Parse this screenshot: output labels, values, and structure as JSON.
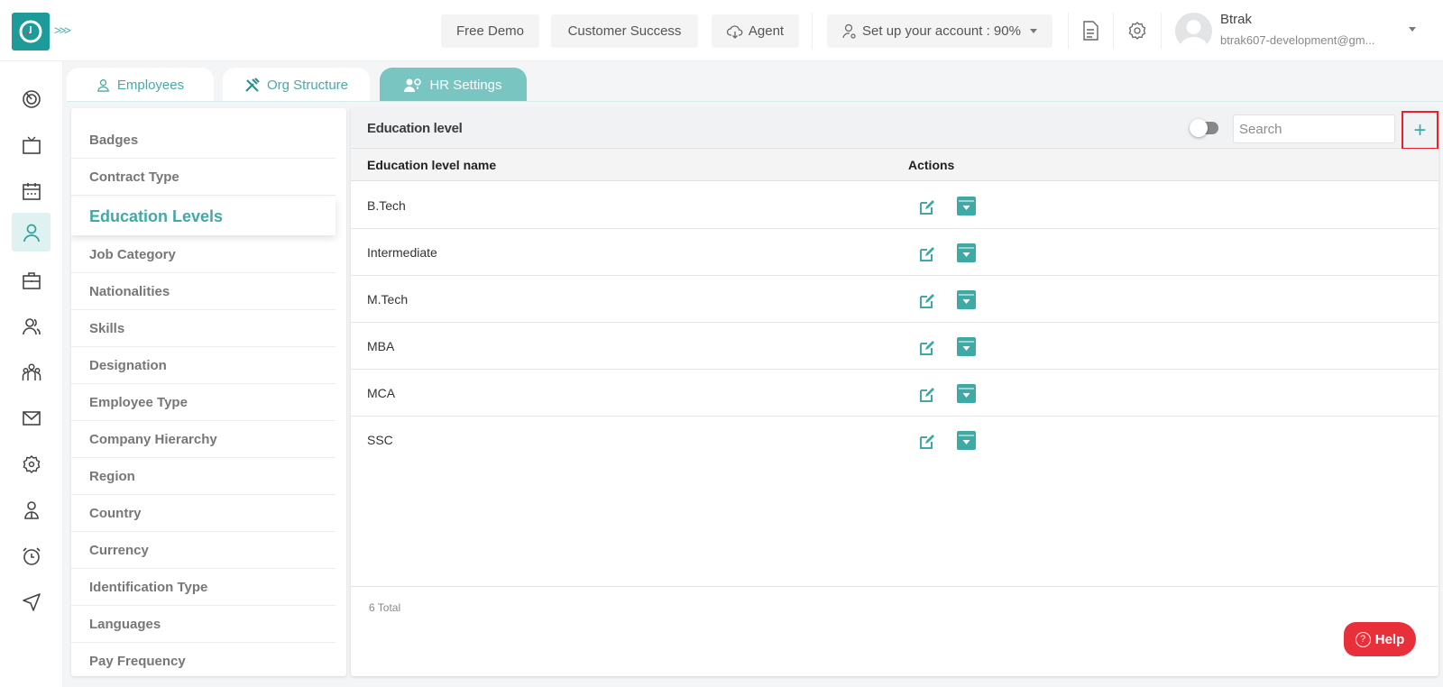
{
  "topbar": {
    "free_demo": "Free Demo",
    "customer_success": "Customer Success",
    "agent": "Agent",
    "setup_account": "Set up your account : 90%",
    "user": {
      "name": "Btrak",
      "email": "btrak607-development@gm..."
    }
  },
  "tabs": [
    {
      "label": "Employees",
      "icon": "user-icon"
    },
    {
      "label": "Org Structure",
      "icon": "tools-icon"
    },
    {
      "label": "HR Settings",
      "icon": "users-gear-icon",
      "active": true
    }
  ],
  "settings_menu": {
    "items": [
      "Badges",
      "Contract Type",
      "Education Levels",
      "Job Category",
      "Nationalities",
      "Skills",
      "Designation",
      "Employee Type",
      "Company Hierarchy",
      "Region",
      "Country",
      "Currency",
      "Identification Type",
      "Languages",
      "Pay Frequency"
    ],
    "active": "Education Levels"
  },
  "panel": {
    "title": "Education level",
    "search_placeholder": "Search",
    "add_label": "+",
    "columns": [
      "Education level name",
      "Actions"
    ],
    "rows": [
      "B.Tech",
      "Intermediate",
      "M.Tech",
      "MBA",
      "MCA",
      "SSC"
    ],
    "total": "6 Total"
  },
  "help": {
    "label": "Help"
  },
  "colors": {
    "brand": "#1d9a9a",
    "accent": "#43a9a6",
    "help": "#e7303a",
    "highlight": "#e8222b"
  }
}
